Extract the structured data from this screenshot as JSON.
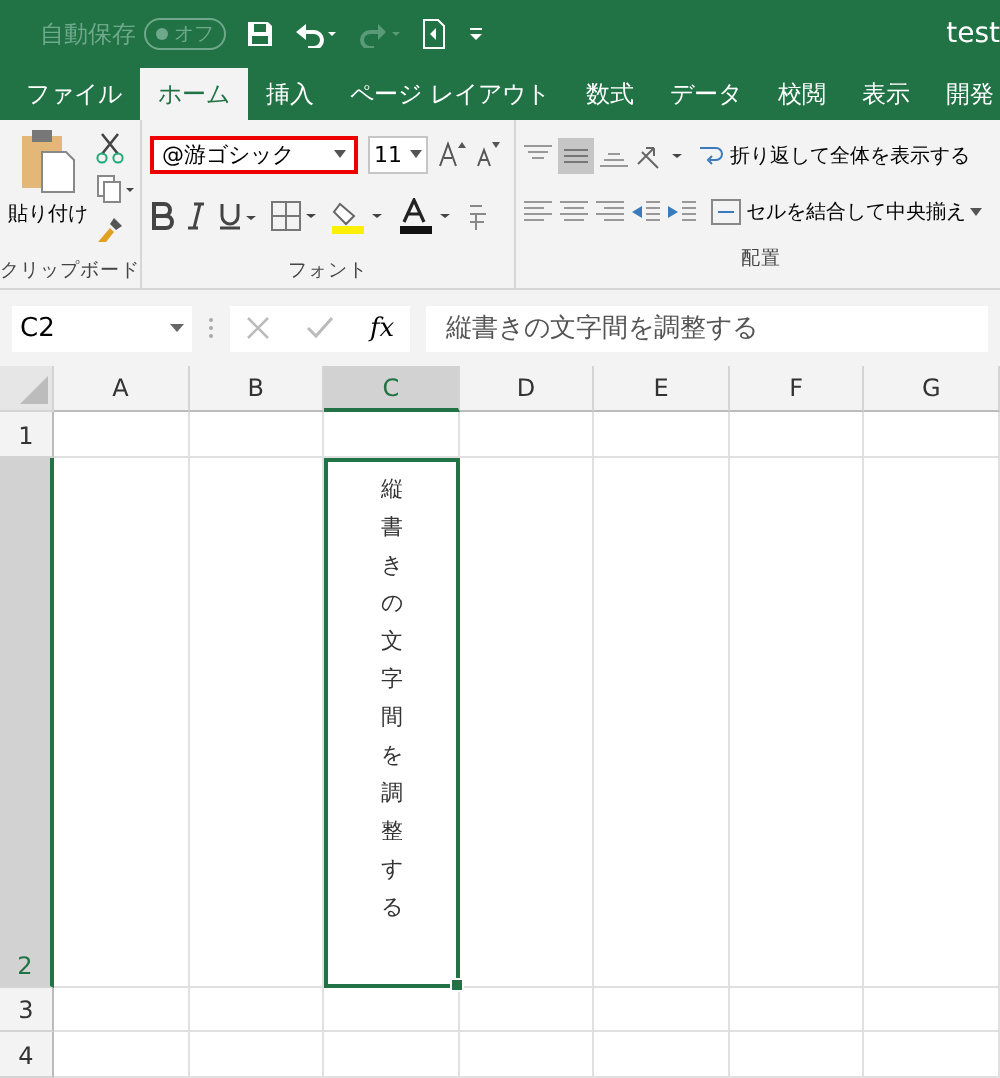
{
  "title_bar": {
    "autosave_label": "自動保存",
    "autosave_toggle": {
      "label": "オフ",
      "on": false
    },
    "title": "test"
  },
  "tabs": [
    {
      "label": "ファイル",
      "selected": false
    },
    {
      "label": "ホーム",
      "selected": true
    },
    {
      "label": "挿入",
      "selected": false
    },
    {
      "label": "ページ レイアウト",
      "selected": false
    },
    {
      "label": "数式",
      "selected": false
    },
    {
      "label": "データ",
      "selected": false
    },
    {
      "label": "校閲",
      "selected": false
    },
    {
      "label": "表示",
      "selected": false
    },
    {
      "label": "開発",
      "selected": false
    }
  ],
  "ribbon": {
    "clipboard": {
      "paste": "貼り付け",
      "label": "クリップボード"
    },
    "font": {
      "font_name": "@游ゴシック",
      "font_size": "11",
      "label": "フォント"
    },
    "alignment": {
      "wrap_text": "折り返して全体を表示する",
      "merge_center": "セルを結合して中央揃え",
      "label": "配置"
    }
  },
  "formula_bar": {
    "name_box": "C2",
    "fx": "fx",
    "value": "縦書きの文字間を調整する"
  },
  "sheet": {
    "columns": [
      {
        "label": "A",
        "selected": false
      },
      {
        "label": "B",
        "selected": false
      },
      {
        "label": "C",
        "selected": true
      },
      {
        "label": "D",
        "selected": false
      },
      {
        "label": "E",
        "selected": false
      },
      {
        "label": "F",
        "selected": false
      },
      {
        "label": "G",
        "selected": false
      }
    ],
    "rows": [
      {
        "label": "1",
        "selected": false
      },
      {
        "label": "2",
        "selected": true
      },
      {
        "label": "3",
        "selected": false
      },
      {
        "label": "4",
        "selected": false
      }
    ],
    "active_cell": {
      "text": "縦書きの文字間を調整する"
    }
  }
}
